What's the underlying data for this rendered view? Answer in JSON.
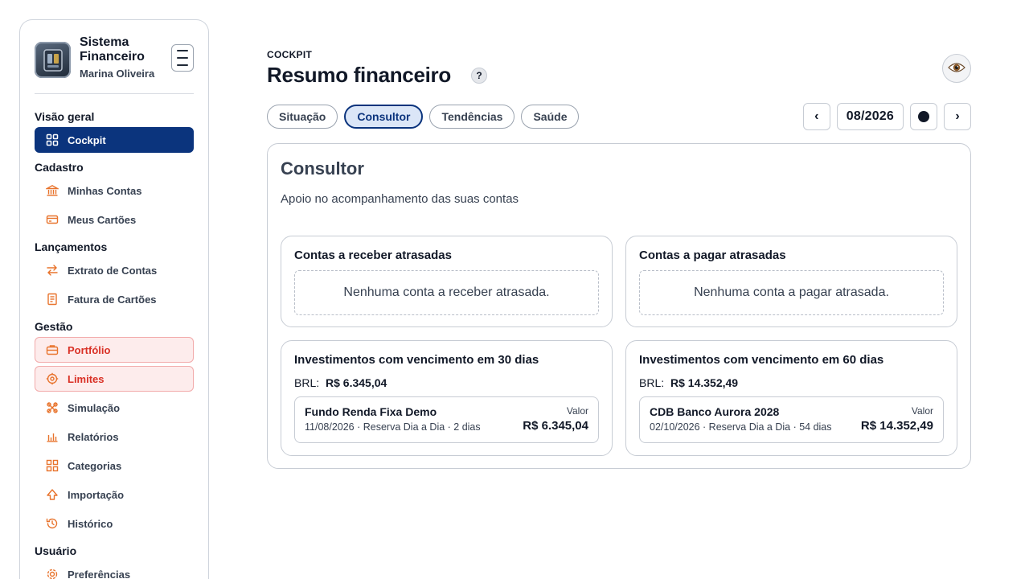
{
  "brand": {
    "title": "Sistema Financeiro",
    "user": "Marina Oliveira"
  },
  "sidebar": {
    "sections": [
      {
        "label": "Visão geral"
      },
      {
        "label": "Cadastro"
      },
      {
        "label": "Lançamentos"
      },
      {
        "label": "Gestão"
      },
      {
        "label": "Usuário"
      }
    ],
    "items": [
      {
        "label": "Cockpit",
        "icon": "grid-icon"
      },
      {
        "label": "Minhas Contas",
        "icon": "bank-icon"
      },
      {
        "label": "Meus Cartões",
        "icon": "card-icon"
      },
      {
        "label": "Extrato de Contas",
        "icon": "transfer-icon"
      },
      {
        "label": "Fatura de Cartões",
        "icon": "invoice-icon"
      },
      {
        "label": "Portfólio",
        "icon": "briefcase-icon"
      },
      {
        "label": "Limites",
        "icon": "target-icon"
      },
      {
        "label": "Simulação",
        "icon": "simulation-icon"
      },
      {
        "label": "Relatórios",
        "icon": "chart-icon"
      },
      {
        "label": "Categorias",
        "icon": "categories-icon"
      },
      {
        "label": "Importação",
        "icon": "upload-icon"
      },
      {
        "label": "Histórico",
        "icon": "history-icon"
      },
      {
        "label": "Preferências",
        "icon": "settings-icon"
      }
    ],
    "accent_color": "#0b347d",
    "icon_color": "#e8732c",
    "alert_color": "#d93025"
  },
  "header": {
    "eyebrow": "COCKPIT",
    "title": "Resumo financeiro",
    "help": "?"
  },
  "tabs": [
    {
      "label": "Situação"
    },
    {
      "label": "Consultor"
    },
    {
      "label": "Tendências"
    },
    {
      "label": "Saúde"
    }
  ],
  "period": {
    "prev": "‹",
    "value": "08/2026",
    "next": "›"
  },
  "panel": {
    "title": "Consultor",
    "subtitle": "Apoio no acompanhamento das suas contas",
    "receivables": {
      "title": "Contas a receber atrasadas",
      "empty": "Nenhuma conta a receber atrasada."
    },
    "payables": {
      "title": "Contas a pagar atrasadas",
      "empty": "Nenhuma conta a pagar atrasada."
    },
    "inv30": {
      "title": "Investimentos com vencimento em 30 dias",
      "currency": "BRL:",
      "total": "R$ 6.345,04",
      "item": {
        "name": "Fundo Renda Fixa Demo",
        "meta": "11/08/2026 · Reserva Dia a Dia · 2 dias",
        "label": "Valor",
        "value": "R$ 6.345,04"
      }
    },
    "inv60": {
      "title": "Investimentos com vencimento em 60 dias",
      "currency": "BRL:",
      "total": "R$ 14.352,49",
      "item": {
        "name": "CDB Banco Aurora 2028",
        "meta": "02/10/2026 · Reserva Dia a Dia · 54 dias",
        "label": "Valor",
        "value": "R$ 14.352,49"
      }
    }
  }
}
